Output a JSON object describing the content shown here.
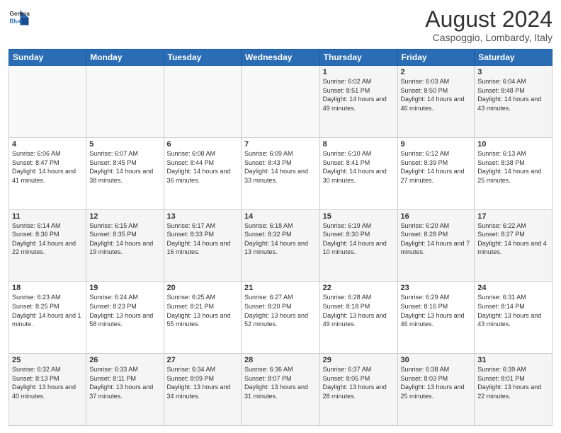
{
  "header": {
    "logo_line1": "General",
    "logo_line2": "Blue",
    "title": "August 2024",
    "location": "Caspoggio, Lombardy, Italy"
  },
  "days_of_week": [
    "Sunday",
    "Monday",
    "Tuesday",
    "Wednesday",
    "Thursday",
    "Friday",
    "Saturday"
  ],
  "weeks": [
    [
      {
        "day": "",
        "info": ""
      },
      {
        "day": "",
        "info": ""
      },
      {
        "day": "",
        "info": ""
      },
      {
        "day": "",
        "info": ""
      },
      {
        "day": "1",
        "info": "Sunrise: 6:02 AM\nSunset: 8:51 PM\nDaylight: 14 hours and 49 minutes."
      },
      {
        "day": "2",
        "info": "Sunrise: 6:03 AM\nSunset: 8:50 PM\nDaylight: 14 hours and 46 minutes."
      },
      {
        "day": "3",
        "info": "Sunrise: 6:04 AM\nSunset: 8:48 PM\nDaylight: 14 hours and 43 minutes."
      }
    ],
    [
      {
        "day": "4",
        "info": "Sunrise: 6:06 AM\nSunset: 8:47 PM\nDaylight: 14 hours and 41 minutes."
      },
      {
        "day": "5",
        "info": "Sunrise: 6:07 AM\nSunset: 8:45 PM\nDaylight: 14 hours and 38 minutes."
      },
      {
        "day": "6",
        "info": "Sunrise: 6:08 AM\nSunset: 8:44 PM\nDaylight: 14 hours and 36 minutes."
      },
      {
        "day": "7",
        "info": "Sunrise: 6:09 AM\nSunset: 8:43 PM\nDaylight: 14 hours and 33 minutes."
      },
      {
        "day": "8",
        "info": "Sunrise: 6:10 AM\nSunset: 8:41 PM\nDaylight: 14 hours and 30 minutes."
      },
      {
        "day": "9",
        "info": "Sunrise: 6:12 AM\nSunset: 8:39 PM\nDaylight: 14 hours and 27 minutes."
      },
      {
        "day": "10",
        "info": "Sunrise: 6:13 AM\nSunset: 8:38 PM\nDaylight: 14 hours and 25 minutes."
      }
    ],
    [
      {
        "day": "11",
        "info": "Sunrise: 6:14 AM\nSunset: 8:36 PM\nDaylight: 14 hours and 22 minutes."
      },
      {
        "day": "12",
        "info": "Sunrise: 6:15 AM\nSunset: 8:35 PM\nDaylight: 14 hours and 19 minutes."
      },
      {
        "day": "13",
        "info": "Sunrise: 6:17 AM\nSunset: 8:33 PM\nDaylight: 14 hours and 16 minutes."
      },
      {
        "day": "14",
        "info": "Sunrise: 6:18 AM\nSunset: 8:32 PM\nDaylight: 14 hours and 13 minutes."
      },
      {
        "day": "15",
        "info": "Sunrise: 6:19 AM\nSunset: 8:30 PM\nDaylight: 14 hours and 10 minutes."
      },
      {
        "day": "16",
        "info": "Sunrise: 6:20 AM\nSunset: 8:28 PM\nDaylight: 14 hours and 7 minutes."
      },
      {
        "day": "17",
        "info": "Sunrise: 6:22 AM\nSunset: 8:27 PM\nDaylight: 14 hours and 4 minutes."
      }
    ],
    [
      {
        "day": "18",
        "info": "Sunrise: 6:23 AM\nSunset: 8:25 PM\nDaylight: 14 hours and 1 minute."
      },
      {
        "day": "19",
        "info": "Sunrise: 6:24 AM\nSunset: 8:23 PM\nDaylight: 13 hours and 58 minutes."
      },
      {
        "day": "20",
        "info": "Sunrise: 6:25 AM\nSunset: 8:21 PM\nDaylight: 13 hours and 55 minutes."
      },
      {
        "day": "21",
        "info": "Sunrise: 6:27 AM\nSunset: 8:20 PM\nDaylight: 13 hours and 52 minutes."
      },
      {
        "day": "22",
        "info": "Sunrise: 6:28 AM\nSunset: 8:18 PM\nDaylight: 13 hours and 49 minutes."
      },
      {
        "day": "23",
        "info": "Sunrise: 6:29 AM\nSunset: 8:16 PM\nDaylight: 13 hours and 46 minutes."
      },
      {
        "day": "24",
        "info": "Sunrise: 6:31 AM\nSunset: 8:14 PM\nDaylight: 13 hours and 43 minutes."
      }
    ],
    [
      {
        "day": "25",
        "info": "Sunrise: 6:32 AM\nSunset: 8:13 PM\nDaylight: 13 hours and 40 minutes."
      },
      {
        "day": "26",
        "info": "Sunrise: 6:33 AM\nSunset: 8:11 PM\nDaylight: 13 hours and 37 minutes."
      },
      {
        "day": "27",
        "info": "Sunrise: 6:34 AM\nSunset: 8:09 PM\nDaylight: 13 hours and 34 minutes."
      },
      {
        "day": "28",
        "info": "Sunrise: 6:36 AM\nSunset: 8:07 PM\nDaylight: 13 hours and 31 minutes."
      },
      {
        "day": "29",
        "info": "Sunrise: 6:37 AM\nSunset: 8:05 PM\nDaylight: 13 hours and 28 minutes."
      },
      {
        "day": "30",
        "info": "Sunrise: 6:38 AM\nSunset: 8:03 PM\nDaylight: 13 hours and 25 minutes."
      },
      {
        "day": "31",
        "info": "Sunrise: 6:39 AM\nSunset: 8:01 PM\nDaylight: 13 hours and 22 minutes."
      }
    ]
  ]
}
